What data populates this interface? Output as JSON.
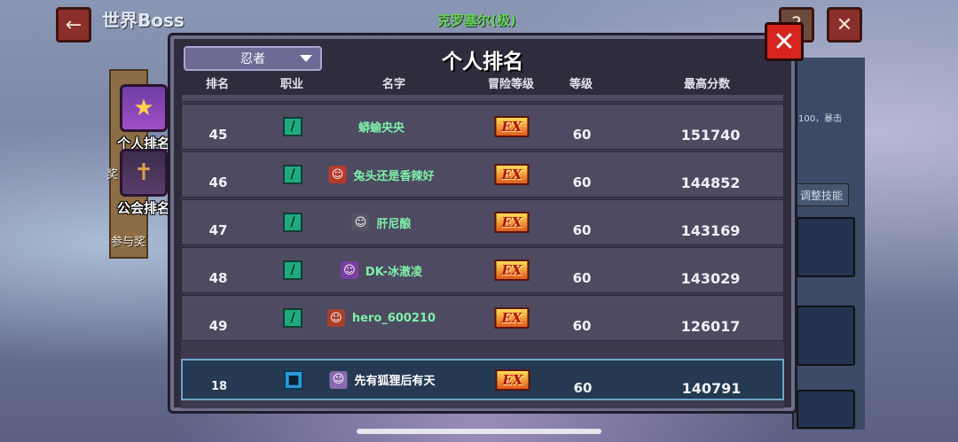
{
  "bg": {
    "title": "世界Boss",
    "boss_name": "克罗塞尔(极)",
    "back_icon": "arrow-left-icon",
    "help_icon": "question-icon",
    "labels": [
      "奖",
      "参与奖"
    ],
    "right_button": "调整技能",
    "right_text": "100，暴击"
  },
  "side_tabs": [
    {
      "label": "个人排名",
      "icon": "trophy-icon",
      "active": true
    },
    {
      "label": "公会排名",
      "icon": "guild-shield-icon",
      "active": false
    }
  ],
  "panel": {
    "title": "个人排名",
    "class_filter": "忍者",
    "close_icon": "close-icon",
    "accent_color": "#d7241f"
  },
  "columns": [
    "排名",
    "职业",
    "名字",
    "冒险等级",
    "等级",
    "最高分数"
  ],
  "rows": [
    {
      "rank": "45",
      "job": "sword-icon",
      "name": "蟒蝓央央",
      "adventure_level": "EX",
      "level": "60",
      "score": "151740",
      "has_avatar": false
    },
    {
      "rank": "46",
      "job": "sword-icon",
      "name": "兔头还是香辣好",
      "adventure_level": "EX",
      "level": "60",
      "score": "144852",
      "has_avatar": true
    },
    {
      "rank": "47",
      "job": "sword-icon",
      "name": "肝尼酿",
      "adventure_level": "EX",
      "level": "60",
      "score": "143169",
      "has_avatar": true
    },
    {
      "rank": "48",
      "job": "sword-icon",
      "name": "DK-冰澈凌",
      "adventure_level": "EX",
      "level": "60",
      "score": "143029",
      "has_avatar": true
    },
    {
      "rank": "49",
      "job": "sword-icon",
      "name": "hero_600210",
      "adventure_level": "EX",
      "level": "60",
      "score": "126017",
      "has_avatar": true
    }
  ],
  "self_row": {
    "rank": "18",
    "job": "shield-icon",
    "name": "先有狐狸后有天",
    "adventure_level": "EX",
    "level": "60",
    "score": "140791"
  }
}
